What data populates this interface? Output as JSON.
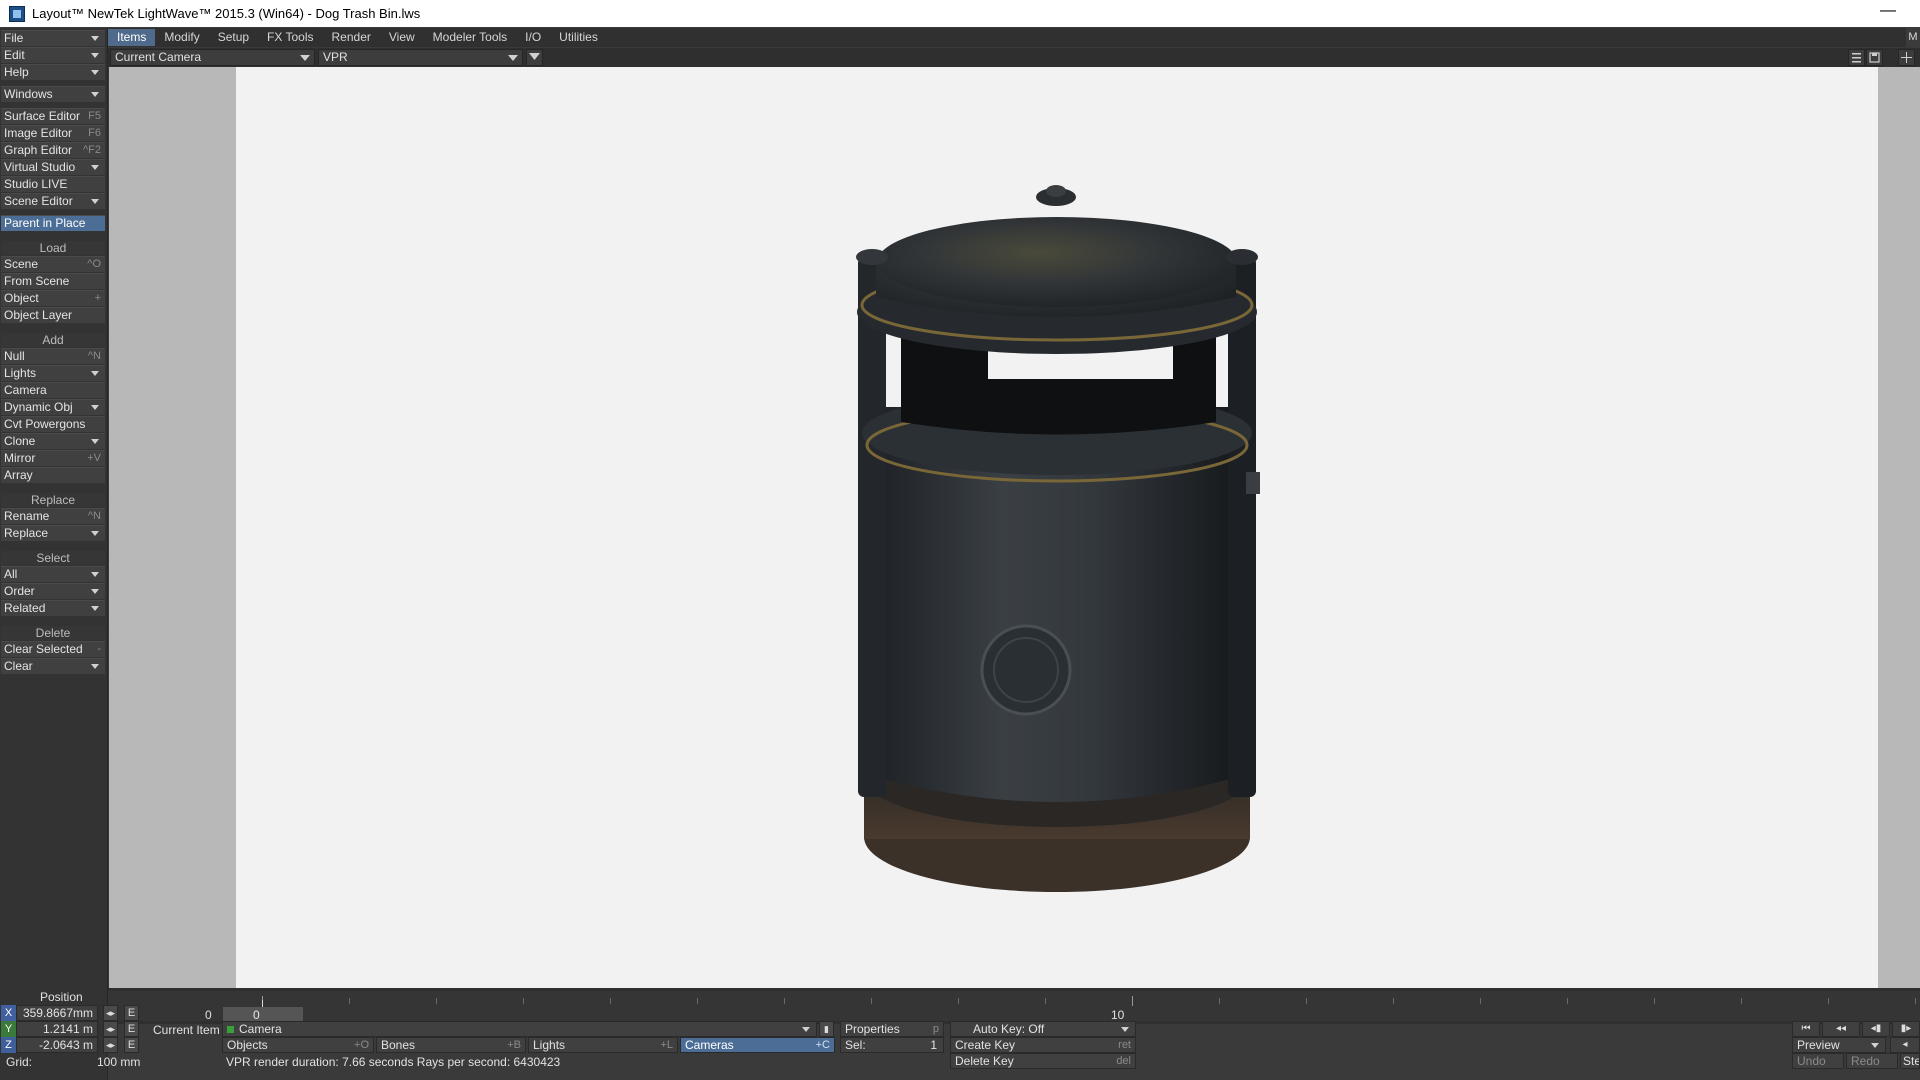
{
  "window": {
    "title": "Layout™ NewTek LightWave™ 2015.3 (Win64) - Dog Trash Bin.lws",
    "minimize": "—"
  },
  "tabs": [
    "Items",
    "Modify",
    "Setup",
    "FX Tools",
    "Render",
    "View",
    "Modeler Tools",
    "I/O",
    "Utilities"
  ],
  "tabs_right": "M",
  "viewport_toolbar": {
    "camera_select": "Current Camera",
    "render_mode": "VPR"
  },
  "left_panel": {
    "top_menus": [
      "File",
      "Edit",
      "Help"
    ],
    "windows": "Windows",
    "editors": [
      {
        "label": "Surface Editor",
        "shortcut": "F5"
      },
      {
        "label": "Image Editor",
        "shortcut": "F6"
      },
      {
        "label": "Graph Editor",
        "shortcut": "^F2"
      },
      {
        "label": "Virtual Studio",
        "shortcut": ""
      },
      {
        "label": "Studio LIVE",
        "shortcut": ""
      },
      {
        "label": "Scene Editor",
        "shortcut": ""
      }
    ],
    "parent_in_place": "Parent in Place",
    "load_header": "Load",
    "load_items": [
      {
        "label": "Scene",
        "shortcut": "^O"
      },
      {
        "label": "From Scene",
        "shortcut": ""
      },
      {
        "label": "Object",
        "shortcut": "+"
      },
      {
        "label": "Object Layer",
        "shortcut": ""
      }
    ],
    "add_header": "Add",
    "add_items": [
      {
        "label": "Null",
        "shortcut": "^N"
      },
      {
        "label": "Lights",
        "shortcut": ""
      },
      {
        "label": "Camera",
        "shortcut": ""
      },
      {
        "label": "Dynamic Obj",
        "shortcut": ""
      },
      {
        "label": "Cvt Powergons",
        "shortcut": ""
      },
      {
        "label": "Clone",
        "shortcut": ""
      },
      {
        "label": "Mirror",
        "shortcut": "+V"
      },
      {
        "label": "Array",
        "shortcut": ""
      }
    ],
    "replace_header": "Replace",
    "replace_items": [
      {
        "label": "Rename",
        "shortcut": "^N"
      },
      {
        "label": "Replace",
        "shortcut": ""
      }
    ],
    "select_header": "Select",
    "select_items": [
      {
        "label": "All",
        "shortcut": ""
      },
      {
        "label": "Order",
        "shortcut": ""
      },
      {
        "label": "Related",
        "shortcut": ""
      }
    ],
    "delete_header": "Delete",
    "delete_items": [
      {
        "label": "Clear Selected",
        "shortcut": "-"
      },
      {
        "label": "Clear",
        "shortcut": ""
      }
    ]
  },
  "timeline": {
    "start_frame": "0",
    "current_frame": "0",
    "marker_10": "10"
  },
  "bottom": {
    "position_label": "Position",
    "x_axis": "X",
    "y_axis": "Y",
    "z_axis": "Z",
    "x_value": "359.8667mm",
    "y_value": "1.2141 m",
    "z_value": "-2.0643 m",
    "e_label": "E",
    "current_item_label": "Current Item",
    "current_item_value": "Camera",
    "properties_label": "Properties",
    "properties_shortcut": "p",
    "autokey_label": "Auto Key: Off",
    "objects_label": "Objects",
    "objects_shortcut": "+O",
    "bones_label": "Bones",
    "bones_shortcut": "+B",
    "lights_label": "Lights",
    "lights_shortcut": "+L",
    "cameras_label": "Cameras",
    "cameras_shortcut": "+C",
    "sel_label": "Sel:",
    "sel_value": "1",
    "create_key_label": "Create Key",
    "create_key_shortcut": "ret",
    "delete_key_label": "Delete Key",
    "delete_key_shortcut": "del",
    "grid_label": "Grid:",
    "grid_value": "100 mm",
    "status": "VPR render duration: 7.66 seconds  Rays per second: 6430423",
    "preview_label": "Preview",
    "undo_label": "Undo",
    "redo_label": "Redo",
    "step_label": "Ste"
  },
  "colors": {
    "accent": "#4b6d96",
    "panel": "#333333",
    "canvas": "#f2f2f2"
  }
}
